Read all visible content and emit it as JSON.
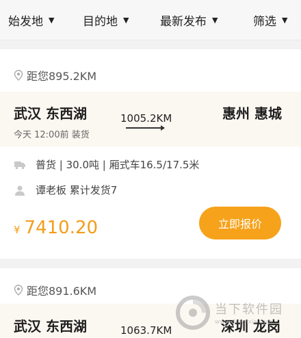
{
  "filters": {
    "origin": "始发地",
    "destination": "目的地",
    "latest": "最新发布",
    "filter": "筛选"
  },
  "orders": [
    {
      "distance_from_you": "距您895.2KM",
      "from_city": "武汉 东西湖",
      "to_city": "惠州 惠城",
      "route_distance": "1005.2KM",
      "load_time": "今天 12:00前 装货",
      "cargo_info": "普货 | 30.0吨 | 厢式车16.5/17.5米",
      "owner_info": "谭老板  累计发货7",
      "currency": "¥",
      "price": "7410.20",
      "quote_label": "立即报价"
    },
    {
      "distance_from_you": "距您891.6KM",
      "from_city": "武汉 东西湖",
      "to_city": "深圳 龙岗",
      "route_distance": "1063.7KM"
    }
  ],
  "watermark": {
    "title": "当下软件园",
    "url": "www.downxia.com"
  },
  "colors": {
    "accent": "#f6a21a",
    "price": "#f29d1a"
  }
}
